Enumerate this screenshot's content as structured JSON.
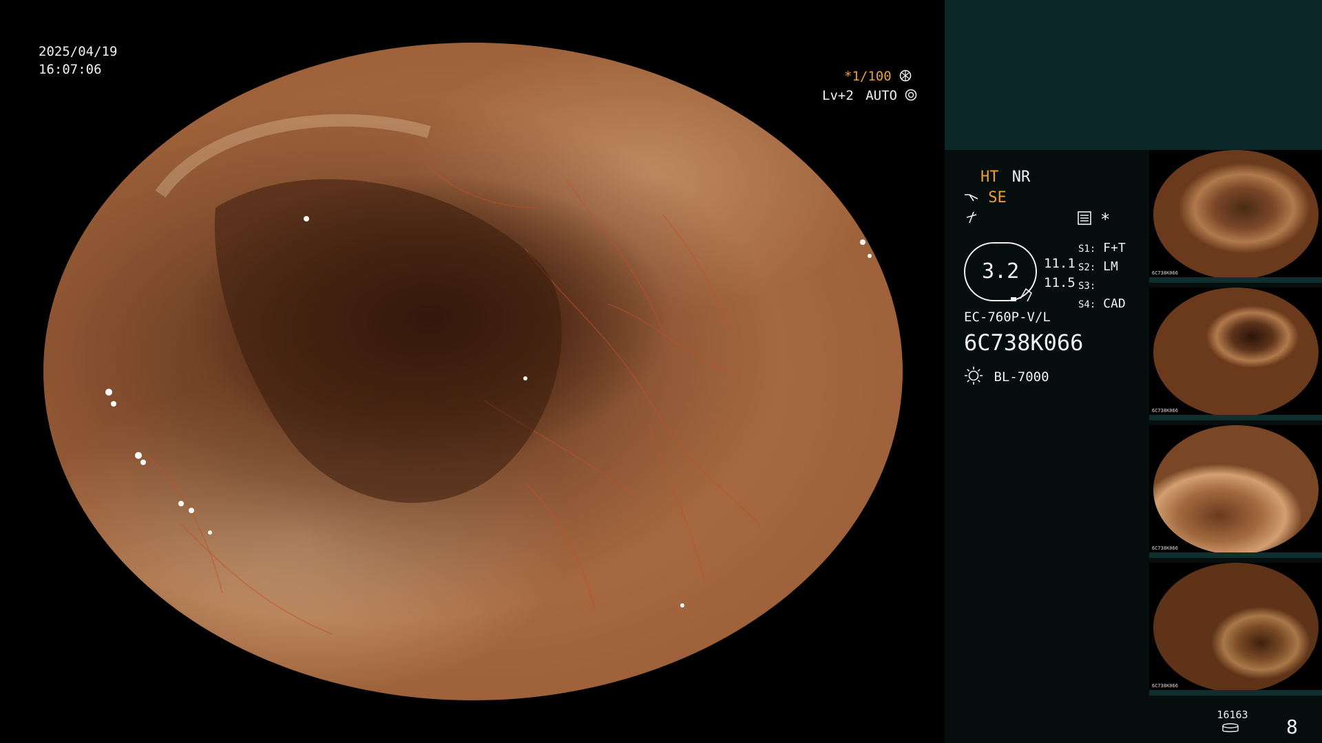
{
  "overlay": {
    "date": "2025/04/19",
    "time": "16:07:06",
    "shutter": "*1/100",
    "level": "Lv+2",
    "iris": "AUTO"
  },
  "panel": {
    "ht": "HT",
    "nr": "NR",
    "se": "SE",
    "structure_value": "3.2",
    "value_a": "11.1",
    "value_b": "11.5",
    "switches": [
      {
        "key": "S1:",
        "value": "F+T"
      },
      {
        "key": "S2:",
        "value": "LM"
      },
      {
        "key": "S3:",
        "value": ""
      },
      {
        "key": "S4:",
        "value": "CAD"
      }
    ],
    "scope_model": "EC-760P-V/L",
    "scope_serial": "6C738K066",
    "light_source": "BL-7000",
    "record_count": "16163",
    "frame_count": "8",
    "asterisk": "*"
  },
  "thumbnails": {
    "serial": "6C738K066",
    "light": "BL-7000"
  },
  "colors": {
    "accent_yellow": "#f0a030",
    "panel_bg": "#050d0d",
    "panel_top_bg": "#0b2626"
  },
  "icons": [
    "aperture-icon",
    "iris-icon",
    "scope-angle-icon",
    "bolt-icon",
    "menu-list-icon",
    "light-icon",
    "database-icon"
  ]
}
